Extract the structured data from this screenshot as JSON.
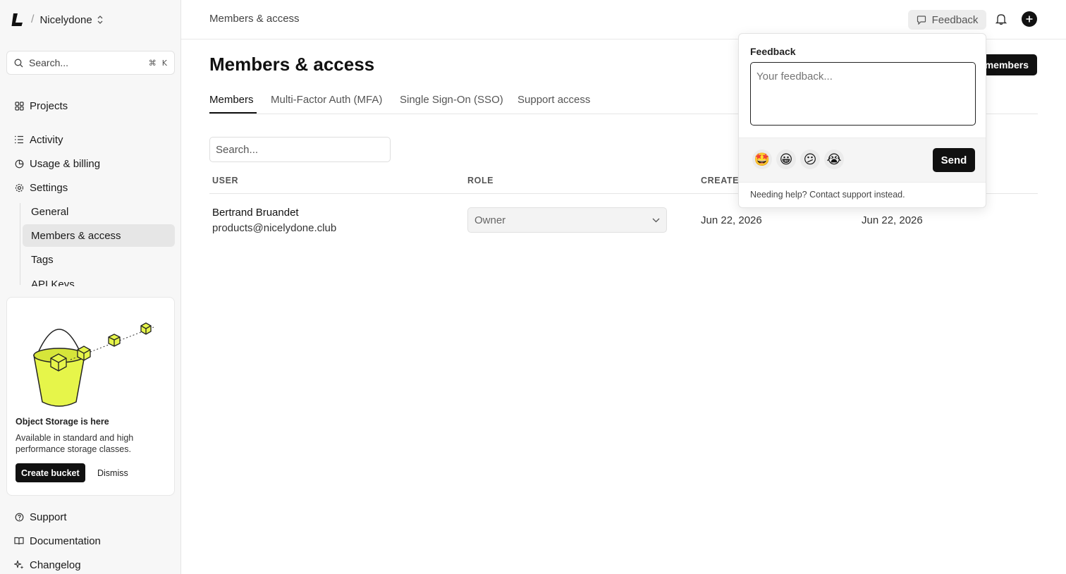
{
  "sidebar": {
    "org_name": "Nicelydone",
    "search": {
      "placeholder": "Search...",
      "shortcut_cmd": "⌘",
      "shortcut_key": "K"
    },
    "nav": {
      "projects": "Projects",
      "activity": "Activity",
      "usage_billing": "Usage & billing",
      "settings": "Settings",
      "support": "Support",
      "documentation": "Documentation",
      "changelog": "Changelog"
    },
    "settings_sub": {
      "general": "General",
      "members_access": "Members & access",
      "tags": "Tags",
      "api_keys": "API Keys"
    },
    "promo": {
      "title": "Object Storage is here",
      "description": "Available in standard and high performance storage classes.",
      "create_label": "Create bucket",
      "dismiss_label": "Dismiss"
    }
  },
  "header": {
    "breadcrumb": "Members & access",
    "feedback_label": "Feedback"
  },
  "main": {
    "title": "Members & access",
    "add_button_label": "members",
    "tabs": [
      "Members",
      "Multi-Factor Auth (MFA)",
      "Single Sign-On (SSO)",
      "Support access"
    ],
    "search_placeholder": "Search...",
    "columns": {
      "user": "USER",
      "role": "ROLE",
      "created": "CREATE"
    },
    "rows": [
      {
        "name": "Bertrand Bruandet",
        "email": "products@nicelydone.club",
        "role": "Owner",
        "created": "Jun 22, 2026",
        "updated": "Jun 22, 2026"
      }
    ]
  },
  "feedback_popover": {
    "label": "Feedback",
    "placeholder": "Your feedback...",
    "emojis": [
      "🤩",
      "😀",
      "😕",
      "😭"
    ],
    "send_label": "Send",
    "help_text": "Needing help? Contact support instead."
  },
  "colors": {
    "accent": "#111111",
    "promo_lime": "#e6f54a"
  }
}
